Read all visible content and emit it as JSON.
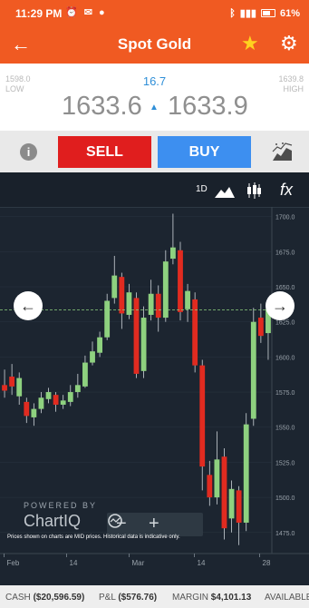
{
  "status": {
    "time": "11:29 PM",
    "battery": "61%"
  },
  "appbar": {
    "title": "Spot Gold"
  },
  "quote": {
    "low_value": "1598.0",
    "low_label": "LOW",
    "high_value": "1639.8",
    "high_label": "HIGH",
    "spread": "16.7",
    "bid": "1633.6",
    "ask": "1633.9"
  },
  "actions": {
    "sell": "SELL",
    "buy": "BUY",
    "info": "i"
  },
  "toolbar": {
    "period": "1D",
    "studies": "fx"
  },
  "chart_data": {
    "type": "candlestick",
    "x_ticks": [
      "Feb",
      "14",
      "Mar",
      "14",
      "28"
    ],
    "y_ticks": [
      "1700.0",
      "1675.0",
      "1650.0",
      "1625.0",
      "1600.0",
      "1575.0",
      "1550.0",
      "1525.0",
      "1500.0",
      "1475.0"
    ],
    "y_range": [
      1460,
      1703
    ],
    "current_price": 1633.6,
    "colors": {
      "up": "#8ed17f",
      "down": "#e12b20",
      "grid": "#2a3540",
      "text": "#9aa3ab"
    },
    "candles": [
      {
        "o": 1580,
        "c": 1576,
        "h": 1591,
        "l": 1571
      },
      {
        "o": 1586,
        "c": 1579,
        "h": 1595,
        "l": 1573
      },
      {
        "o": 1572,
        "c": 1585,
        "h": 1589,
        "l": 1566
      },
      {
        "o": 1568,
        "c": 1558,
        "h": 1571,
        "l": 1553
      },
      {
        "o": 1557,
        "c": 1563,
        "h": 1567,
        "l": 1551
      },
      {
        "o": 1563,
        "c": 1571,
        "h": 1575,
        "l": 1560
      },
      {
        "o": 1570,
        "c": 1575,
        "h": 1578,
        "l": 1567
      },
      {
        "o": 1573,
        "c": 1566,
        "h": 1575,
        "l": 1561
      },
      {
        "o": 1566,
        "c": 1569,
        "h": 1573,
        "l": 1563
      },
      {
        "o": 1568,
        "c": 1575,
        "h": 1580,
        "l": 1565
      },
      {
        "o": 1575,
        "c": 1580,
        "h": 1588,
        "l": 1571
      },
      {
        "o": 1579,
        "c": 1596,
        "h": 1601,
        "l": 1578
      },
      {
        "o": 1596,
        "c": 1604,
        "h": 1611,
        "l": 1594
      },
      {
        "o": 1603,
        "c": 1614,
        "h": 1618,
        "l": 1600
      },
      {
        "o": 1614,
        "c": 1640,
        "h": 1645,
        "l": 1612
      },
      {
        "o": 1642,
        "c": 1658,
        "h": 1672,
        "l": 1638
      },
      {
        "o": 1657,
        "c": 1631,
        "h": 1660,
        "l": 1620
      },
      {
        "o": 1630,
        "c": 1646,
        "h": 1652,
        "l": 1627
      },
      {
        "o": 1642,
        "c": 1588,
        "h": 1646,
        "l": 1585
      },
      {
        "o": 1590,
        "c": 1628,
        "h": 1636,
        "l": 1585
      },
      {
        "o": 1630,
        "c": 1645,
        "h": 1655,
        "l": 1626
      },
      {
        "o": 1645,
        "c": 1628,
        "h": 1651,
        "l": 1618
      },
      {
        "o": 1628,
        "c": 1668,
        "h": 1676,
        "l": 1625
      },
      {
        "o": 1670,
        "c": 1678,
        "h": 1702,
        "l": 1666
      },
      {
        "o": 1676,
        "c": 1632,
        "h": 1682,
        "l": 1626
      },
      {
        "o": 1634,
        "c": 1647,
        "h": 1652,
        "l": 1625
      },
      {
        "o": 1641,
        "c": 1594,
        "h": 1646,
        "l": 1589
      },
      {
        "o": 1594,
        "c": 1522,
        "h": 1598,
        "l": 1505
      },
      {
        "o": 1516,
        "c": 1500,
        "h": 1526,
        "l": 1494
      },
      {
        "o": 1500,
        "c": 1527,
        "h": 1547,
        "l": 1495
      },
      {
        "o": 1529,
        "c": 1478,
        "h": 1535,
        "l": 1470
      },
      {
        "o": 1485,
        "c": 1506,
        "h": 1512,
        "l": 1475
      },
      {
        "o": 1505,
        "c": 1482,
        "h": 1508,
        "l": 1466
      },
      {
        "o": 1482,
        "c": 1552,
        "h": 1560,
        "l": 1476
      },
      {
        "o": 1556,
        "c": 1625,
        "h": 1635,
        "l": 1551
      },
      {
        "o": 1628,
        "c": 1615,
        "h": 1638,
        "l": 1610
      },
      {
        "o": 1617,
        "c": 1634,
        "h": 1640,
        "l": 1598
      }
    ]
  },
  "chart_ui": {
    "powered": "POWERED BY",
    "brand": "ChartIQ",
    "disclaimer": "Prices shown on charts are MID prices. Historical data is indicative only."
  },
  "footer": {
    "cash_label": "CASH",
    "cash_value": "($20,596.59)",
    "pl_label": "P&L",
    "pl_value": "($576.76)",
    "margin_label": "MARGIN",
    "margin_value": "$4,101.13",
    "available_label": "AVAILABLE"
  }
}
